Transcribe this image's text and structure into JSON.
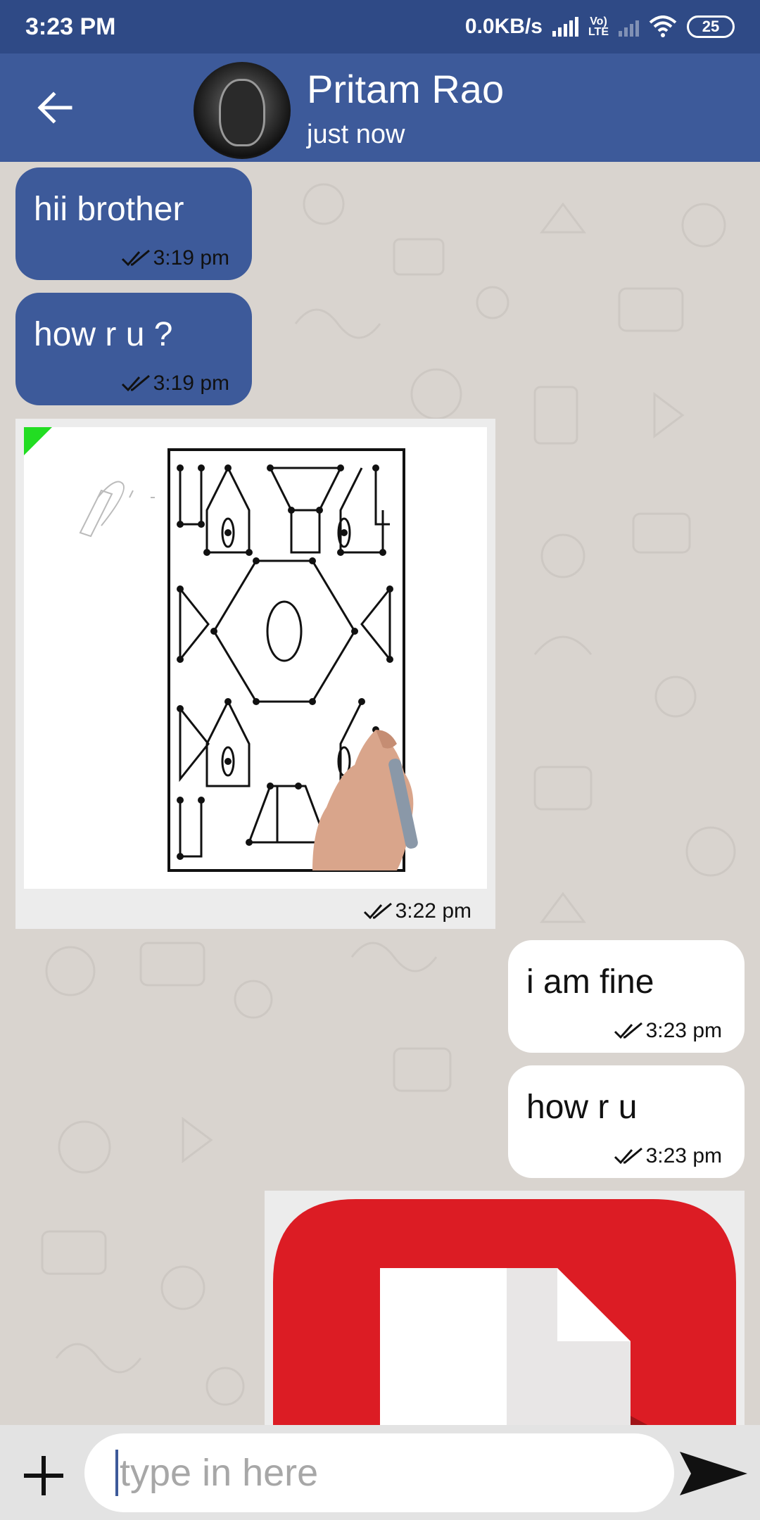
{
  "status_bar": {
    "time": "3:23 PM",
    "net_speed": "0.0KB/s",
    "volte_top": "Vo)",
    "volte_bottom": "LTE",
    "battery": "25",
    "icons": [
      "signal-icon",
      "volte-icon",
      "signal-dim-icon",
      "wifi-icon",
      "battery-icon"
    ]
  },
  "header": {
    "name": "Pritam Rao",
    "status": "just now",
    "back_icon": "arrow-left-icon"
  },
  "messages": [
    {
      "direction": "in",
      "text": "hii brother",
      "time": "3:19 pm"
    },
    {
      "direction": "in",
      "text": "how r u ?",
      "time": "3:19 pm"
    },
    {
      "direction": "in",
      "type": "image",
      "time": "3:22 pm"
    },
    {
      "direction": "out",
      "text": "i am fine",
      "time": "3:23 pm"
    },
    {
      "direction": "out",
      "text": "how r u",
      "time": "3:23 pm"
    },
    {
      "direction": "out",
      "type": "document"
    }
  ],
  "composer": {
    "placeholder": "type in here",
    "add_icon": "plus-icon",
    "send_icon": "send-icon"
  },
  "colors": {
    "status_bar": "#2f4a86",
    "header": "#3d5a9a",
    "incoming_bubble": "#3d5a9a",
    "outgoing_bubble": "#ffffff",
    "chat_background": "#d9d4cf",
    "pdf_red": "#dc1c24"
  }
}
